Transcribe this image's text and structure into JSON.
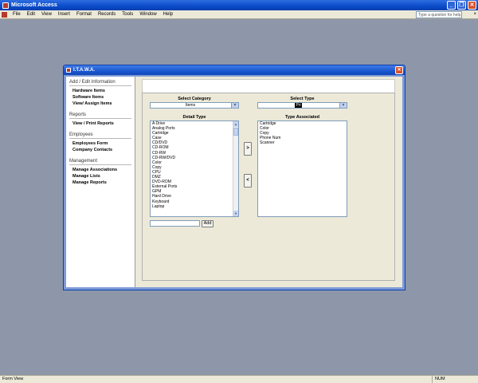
{
  "app": {
    "title": "Microsoft Access"
  },
  "menu": [
    "File",
    "Edit",
    "View",
    "Insert",
    "Format",
    "Records",
    "Tools",
    "Window",
    "Help"
  ],
  "help_box": {
    "placeholder": "Type a question for help"
  },
  "form": {
    "title": "I.T.A.W.A."
  },
  "nav": {
    "sections": [
      {
        "header": "Add / Edit Information",
        "links": [
          "Hardware Items",
          "Software Items",
          "View/ Assign Items"
        ]
      },
      {
        "header": "Reports",
        "links": [
          "View / Print Reports"
        ]
      },
      {
        "header": "Employees",
        "links": [
          "Employees Form",
          "Company Contacts"
        ]
      },
      {
        "header": "Management",
        "links": [
          "Manage Associations",
          "Manage Lists",
          "Manage Reports"
        ]
      }
    ]
  },
  "main": {
    "select_category": {
      "label": "Select Category",
      "value": "Items"
    },
    "select_type": {
      "label": "Select Type",
      "value": "Pri"
    },
    "detail_type": {
      "label": "Detail Type",
      "items": [
        "A Drive",
        "Analog Ports",
        "Cartridge",
        "Case",
        "CD/DVD",
        "CD-ROM",
        "CD-RW",
        "CD-RW/DVD",
        "Color",
        "Copy",
        "CPU",
        "DMZ",
        "DVD-ROM",
        "External Ports",
        "GPM",
        "Hard Drive",
        "Keyboard",
        "Laptop"
      ]
    },
    "type_associated": {
      "label": "Type Associated",
      "items": [
        "Cartridge",
        "Color",
        "Copy",
        "Phone Num",
        "Scanner"
      ]
    },
    "move_right_label": ">",
    "move_left_label": "<",
    "add_button_label": "Add"
  },
  "status": {
    "left": "Form View",
    "num": "NUM"
  }
}
